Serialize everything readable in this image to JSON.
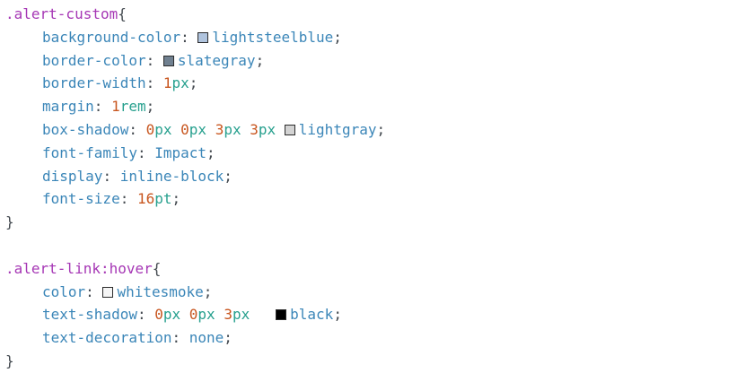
{
  "rules": [
    {
      "selector": ".alert-custom",
      "pseudo": "",
      "open": "{",
      "close": "}",
      "declarations": [
        {
          "property": "background-color",
          "tokens": [
            {
              "type": "swatch",
              "color": "#b0c4de"
            },
            {
              "type": "val",
              "text": "lightsteelblue"
            }
          ]
        },
        {
          "property": "border-color",
          "tokens": [
            {
              "type": "swatch",
              "color": "#708090"
            },
            {
              "type": "val",
              "text": "slategray"
            }
          ]
        },
        {
          "property": "border-width",
          "tokens": [
            {
              "type": "num",
              "text": "1"
            },
            {
              "type": "unit",
              "text": "px"
            }
          ]
        },
        {
          "property": "margin",
          "tokens": [
            {
              "type": "num",
              "text": "1"
            },
            {
              "type": "unit",
              "text": "rem"
            }
          ]
        },
        {
          "property": "box-shadow",
          "tokens": [
            {
              "type": "num",
              "text": "0"
            },
            {
              "type": "unit",
              "text": "px"
            },
            {
              "type": "sp",
              "text": " "
            },
            {
              "type": "num",
              "text": "0"
            },
            {
              "type": "unit",
              "text": "px"
            },
            {
              "type": "sp",
              "text": " "
            },
            {
              "type": "num",
              "text": "3"
            },
            {
              "type": "unit",
              "text": "px"
            },
            {
              "type": "sp",
              "text": " "
            },
            {
              "type": "num",
              "text": "3"
            },
            {
              "type": "unit",
              "text": "px"
            },
            {
              "type": "sp",
              "text": " "
            },
            {
              "type": "swatch",
              "color": "#d3d3d3"
            },
            {
              "type": "val",
              "text": "lightgray"
            }
          ]
        },
        {
          "property": "font-family",
          "tokens": [
            {
              "type": "val",
              "text": "Impact"
            }
          ]
        },
        {
          "property": "display",
          "tokens": [
            {
              "type": "val",
              "text": "inline-block"
            }
          ]
        },
        {
          "property": "font-size",
          "tokens": [
            {
              "type": "num",
              "text": "16"
            },
            {
              "type": "unit",
              "text": "pt"
            }
          ]
        }
      ]
    },
    {
      "selector": ".alert-link",
      "pseudo": ":hover",
      "open": "{",
      "close": "}",
      "declarations": [
        {
          "property": "color",
          "tokens": [
            {
              "type": "swatch",
              "color": "#f5f5f5"
            },
            {
              "type": "val",
              "text": "whitesmoke"
            }
          ]
        },
        {
          "property": "text-shadow",
          "tokens": [
            {
              "type": "num",
              "text": "0"
            },
            {
              "type": "unit",
              "text": "px"
            },
            {
              "type": "sp",
              "text": " "
            },
            {
              "type": "num",
              "text": "0"
            },
            {
              "type": "unit",
              "text": "px"
            },
            {
              "type": "sp",
              "text": " "
            },
            {
              "type": "num",
              "text": "3"
            },
            {
              "type": "unit",
              "text": "px"
            },
            {
              "type": "sp",
              "text": "   "
            },
            {
              "type": "swatch",
              "color": "#000000"
            },
            {
              "type": "val",
              "text": "black"
            }
          ]
        },
        {
          "property": "text-decoration",
          "tokens": [
            {
              "type": "val",
              "text": "none"
            }
          ]
        }
      ]
    }
  ],
  "colors": {
    "selector": "#a637b5",
    "property": "#3b86b8",
    "number": "#c8561f",
    "unit": "#27a08e",
    "punctuation": "#444a50"
  }
}
